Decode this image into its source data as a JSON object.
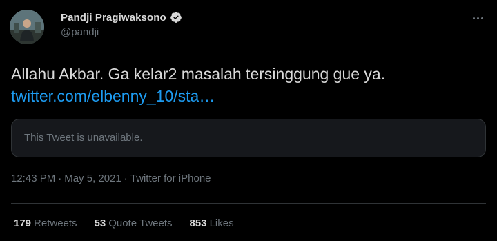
{
  "author": {
    "display_name": "Pandji Pragiwaksono",
    "handle": "@pandji",
    "verified": true
  },
  "tweet": {
    "text": "Allahu Akbar. Ga kelar2 masalah tersinggung gue ya.",
    "link": "twitter.com/elbenny_10/sta…"
  },
  "quoted": {
    "unavailable_text": "This Tweet is unavailable."
  },
  "meta": {
    "time": "12:43 PM",
    "separator": "·",
    "date": "May 5, 2021",
    "source": "Twitter for iPhone"
  },
  "stats": {
    "retweets": {
      "count": "179",
      "label": "Retweets"
    },
    "quote_tweets": {
      "count": "53",
      "label": "Quote Tweets"
    },
    "likes": {
      "count": "853",
      "label": "Likes"
    }
  },
  "colors": {
    "background": "#000000",
    "text": "#d9d9d9",
    "secondary": "#6e767d",
    "link": "#1d9bf0",
    "border": "#2f3336"
  },
  "icons": {
    "verified": "verified-badge-icon",
    "more": "more-options-icon"
  }
}
